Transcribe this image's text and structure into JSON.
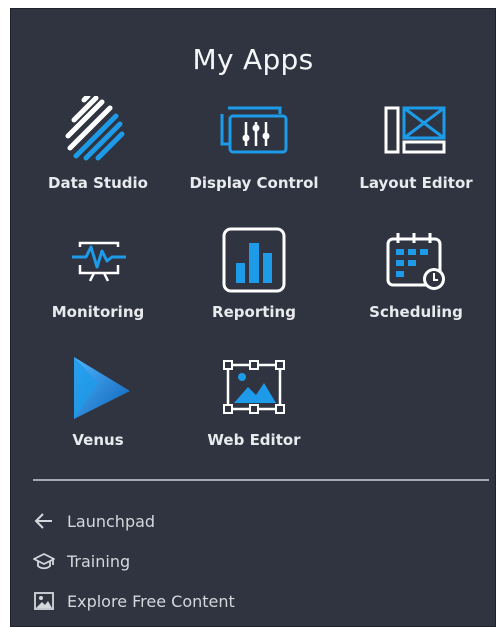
{
  "panel": {
    "title": "My Apps"
  },
  "apps": [
    {
      "label": "Data Studio",
      "icon": "data-studio-icon"
    },
    {
      "label": "Display Control",
      "icon": "display-control-icon"
    },
    {
      "label": "Layout Editor",
      "icon": "layout-editor-icon"
    },
    {
      "label": "Monitoring",
      "icon": "monitoring-icon"
    },
    {
      "label": "Reporting",
      "icon": "reporting-icon"
    },
    {
      "label": "Scheduling",
      "icon": "scheduling-icon"
    },
    {
      "label": "Venus",
      "icon": "venus-icon"
    },
    {
      "label": "Web Editor",
      "icon": "web-editor-icon"
    }
  ],
  "links": [
    {
      "label": "Launchpad",
      "icon": "arrow-left-icon"
    },
    {
      "label": "Training",
      "icon": "graduation-cap-icon"
    },
    {
      "label": "Explore Free Content",
      "icon": "image-icon"
    }
  ],
  "colors": {
    "panel_background": "#2f3440",
    "accent_blue": "#1e9be8",
    "icon_outline": "#ffffff"
  }
}
